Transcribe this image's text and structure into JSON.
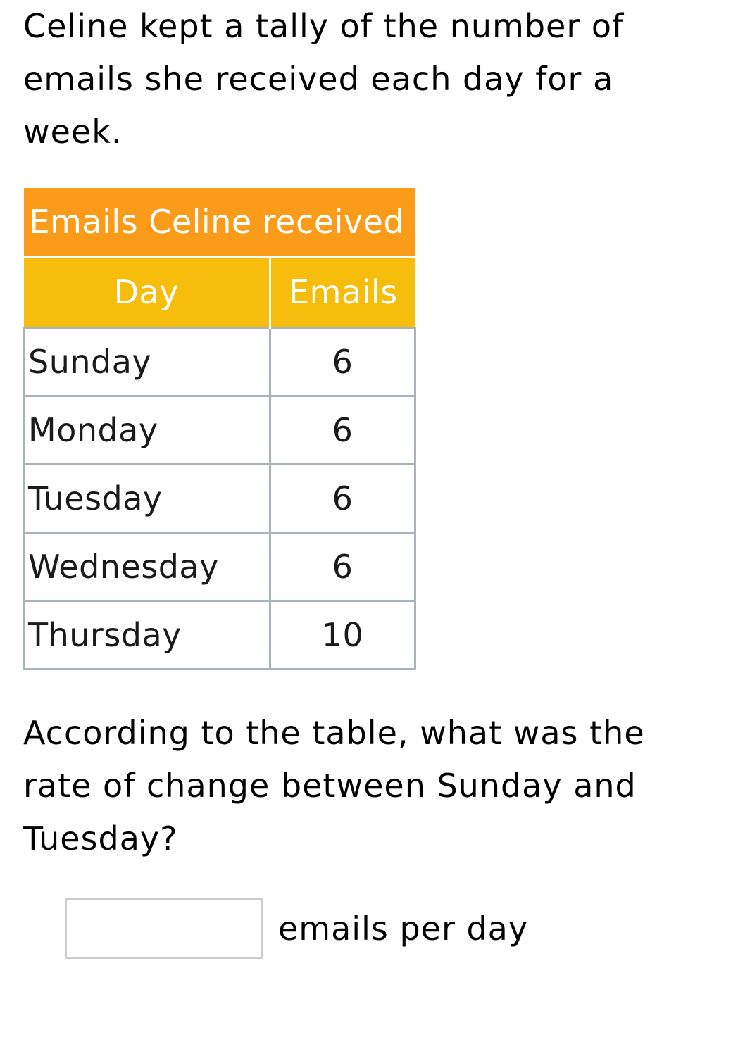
{
  "intro_text": "Celine kept a tally of the number of emails she received each day for a week.",
  "table": {
    "title": "Emails Celine received",
    "headers": {
      "day": "Day",
      "emails": "Emails"
    },
    "rows": [
      {
        "day": "Sunday",
        "emails": "6"
      },
      {
        "day": "Monday",
        "emails": "6"
      },
      {
        "day": "Tuesday",
        "emails": "6"
      },
      {
        "day": "Wednesday",
        "emails": "6"
      },
      {
        "day": "Thursday",
        "emails": "10"
      }
    ],
    "colors": {
      "title_bg": "#fa9b1a",
      "header_bg": "#f6bd0c",
      "border": "#a8b4b9"
    }
  },
  "question_text": "According to the table, what was the rate of change between Sunday and Tuesday?",
  "answer": {
    "value": "",
    "placeholder": "",
    "unit_label": "emails per day"
  }
}
